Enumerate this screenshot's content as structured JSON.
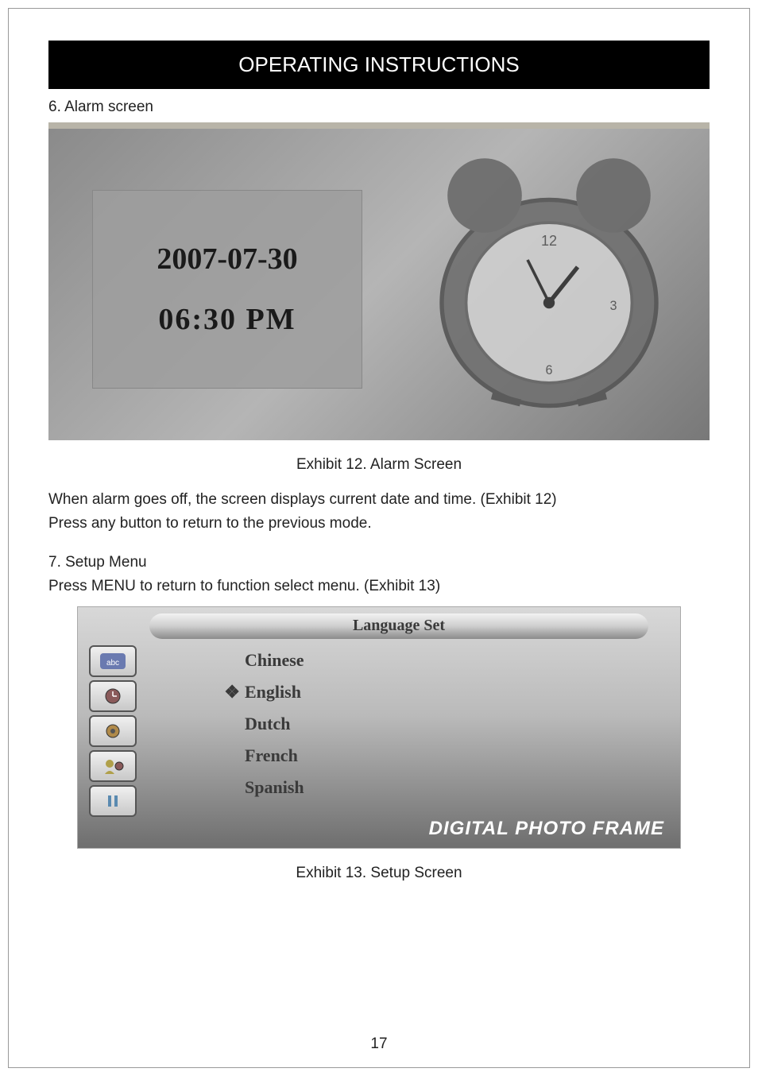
{
  "header": {
    "title": "OPERATING INSTRUCTIONS"
  },
  "section6": {
    "heading": "6. Alarm screen",
    "alarm": {
      "date": "2007-07-30",
      "time": "06:30  PM"
    },
    "caption": "Exhibit 12. Alarm Screen",
    "para1": "When alarm goes off, the screen displays current date and time. (Exhibit 12)",
    "para2": "Press any button to return to the previous mode."
  },
  "section7": {
    "heading": "7. Setup Menu",
    "intro": "Press MENU to return to function select menu. (Exhibit 13)",
    "menu_title": "Language Set",
    "selected_marker": "❖",
    "languages": {
      "0": "Chinese",
      "1": "English",
      "2": "Dutch",
      "3": "French",
      "4": "Spanish"
    },
    "selected_index": 1,
    "sidebar_icons": {
      "0": "abc",
      "1": "clock",
      "2": "gear",
      "3": "user",
      "4": "pause"
    },
    "brand": "DIGITAL PHOTO FRAME",
    "caption": "Exhibit 13. Setup Screen"
  },
  "page_number": "17"
}
